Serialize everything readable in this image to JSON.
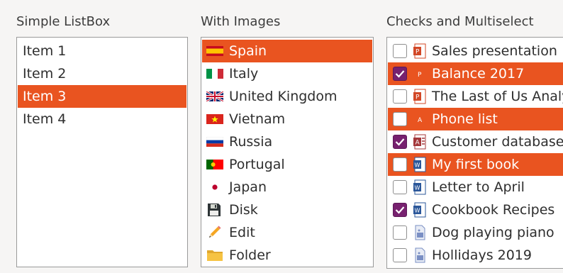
{
  "simple": {
    "title": "Simple ListBox",
    "items": [
      {
        "label": "Item 1",
        "selected": false
      },
      {
        "label": "Item 2",
        "selected": false
      },
      {
        "label": "Item 3",
        "selected": true
      },
      {
        "label": "Item 4",
        "selected": false
      }
    ]
  },
  "images": {
    "title": "With Images",
    "items": [
      {
        "label": "Spain",
        "icon": "spain-flag-icon",
        "selected": true
      },
      {
        "label": "Italy",
        "icon": "italy-flag-icon",
        "selected": false
      },
      {
        "label": "United Kingdom",
        "icon": "uk-flag-icon",
        "selected": false
      },
      {
        "label": "Vietnam",
        "icon": "vietnam-flag-icon",
        "selected": false
      },
      {
        "label": "Russia",
        "icon": "russia-flag-icon",
        "selected": false
      },
      {
        "label": "Portugal",
        "icon": "portugal-flag-icon",
        "selected": false
      },
      {
        "label": "Japan",
        "icon": "japan-flag-icon",
        "selected": false
      },
      {
        "label": "Disk",
        "icon": "floppy-disk-icon",
        "selected": false
      },
      {
        "label": "Edit",
        "icon": "pencil-icon",
        "selected": false
      },
      {
        "label": "Folder",
        "icon": "folder-icon",
        "selected": false
      }
    ]
  },
  "checks": {
    "title": "Checks and Multiselect",
    "items": [
      {
        "label": "Sales presentation",
        "icon": "powerpoint-icon",
        "checked": false,
        "selected": false
      },
      {
        "label": "Balance 2017",
        "icon": "pdf-icon",
        "checked": true,
        "selected": true
      },
      {
        "label": "The Last of Us Analysis",
        "icon": "powerpoint-icon",
        "checked": false,
        "selected": false
      },
      {
        "label": "Phone list",
        "icon": "pdf-icon",
        "checked": false,
        "selected": true
      },
      {
        "label": "Customer database",
        "icon": "access-icon",
        "checked": true,
        "selected": false
      },
      {
        "label": "My first book",
        "icon": "word-icon",
        "checked": false,
        "selected": true
      },
      {
        "label": "Letter to April",
        "icon": "word-icon",
        "checked": false,
        "selected": false
      },
      {
        "label": "Cookbook Recipes",
        "icon": "word-icon",
        "checked": true,
        "selected": false
      },
      {
        "label": "Dog playing piano",
        "icon": "image-file-icon",
        "checked": false,
        "selected": false
      },
      {
        "label": "Hollidays 2019",
        "icon": "image-file-icon",
        "checked": false,
        "selected": false
      }
    ]
  },
  "colors": {
    "selection": "#e95420",
    "check_on": "#77216f"
  }
}
